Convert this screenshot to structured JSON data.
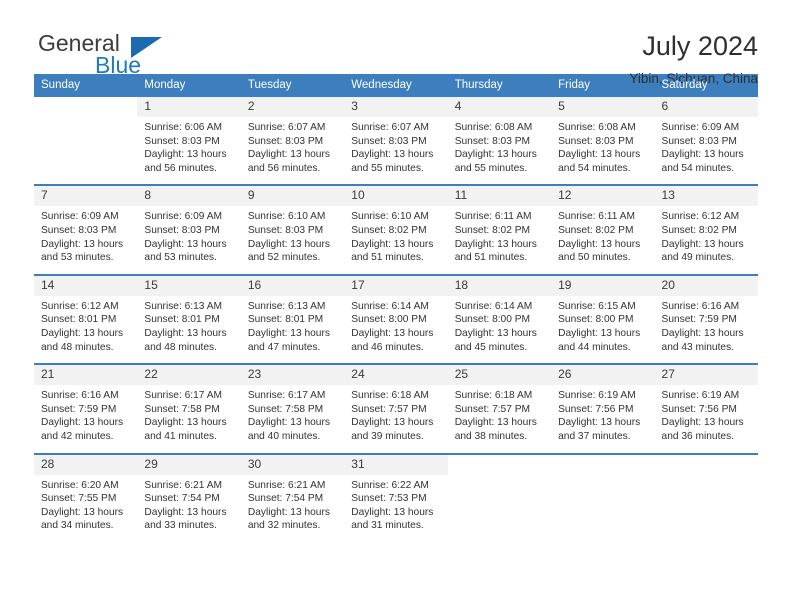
{
  "brand": {
    "name_part1": "General",
    "name_part2": "Blue",
    "accent_color": "#1a6bb0",
    "header_color": "#3d7ebf"
  },
  "header": {
    "title": "July 2024",
    "subtitle": "Yibin, Sichuan, China"
  },
  "calendar": {
    "weekday_headers": [
      "Sunday",
      "Monday",
      "Tuesday",
      "Wednesday",
      "Thursday",
      "Friday",
      "Saturday"
    ],
    "weeks": [
      [
        {
          "day": "",
          "sunrise": "",
          "sunset": "",
          "daylight": "",
          "blank": true
        },
        {
          "day": "1",
          "sunrise": "Sunrise: 6:06 AM",
          "sunset": "Sunset: 8:03 PM",
          "daylight": "Daylight: 13 hours and 56 minutes."
        },
        {
          "day": "2",
          "sunrise": "Sunrise: 6:07 AM",
          "sunset": "Sunset: 8:03 PM",
          "daylight": "Daylight: 13 hours and 56 minutes."
        },
        {
          "day": "3",
          "sunrise": "Sunrise: 6:07 AM",
          "sunset": "Sunset: 8:03 PM",
          "daylight": "Daylight: 13 hours and 55 minutes."
        },
        {
          "day": "4",
          "sunrise": "Sunrise: 6:08 AM",
          "sunset": "Sunset: 8:03 PM",
          "daylight": "Daylight: 13 hours and 55 minutes."
        },
        {
          "day": "5",
          "sunrise": "Sunrise: 6:08 AM",
          "sunset": "Sunset: 8:03 PM",
          "daylight": "Daylight: 13 hours and 54 minutes."
        },
        {
          "day": "6",
          "sunrise": "Sunrise: 6:09 AM",
          "sunset": "Sunset: 8:03 PM",
          "daylight": "Daylight: 13 hours and 54 minutes."
        }
      ],
      [
        {
          "day": "7",
          "sunrise": "Sunrise: 6:09 AM",
          "sunset": "Sunset: 8:03 PM",
          "daylight": "Daylight: 13 hours and 53 minutes."
        },
        {
          "day": "8",
          "sunrise": "Sunrise: 6:09 AM",
          "sunset": "Sunset: 8:03 PM",
          "daylight": "Daylight: 13 hours and 53 minutes."
        },
        {
          "day": "9",
          "sunrise": "Sunrise: 6:10 AM",
          "sunset": "Sunset: 8:03 PM",
          "daylight": "Daylight: 13 hours and 52 minutes."
        },
        {
          "day": "10",
          "sunrise": "Sunrise: 6:10 AM",
          "sunset": "Sunset: 8:02 PM",
          "daylight": "Daylight: 13 hours and 51 minutes."
        },
        {
          "day": "11",
          "sunrise": "Sunrise: 6:11 AM",
          "sunset": "Sunset: 8:02 PM",
          "daylight": "Daylight: 13 hours and 51 minutes."
        },
        {
          "day": "12",
          "sunrise": "Sunrise: 6:11 AM",
          "sunset": "Sunset: 8:02 PM",
          "daylight": "Daylight: 13 hours and 50 minutes."
        },
        {
          "day": "13",
          "sunrise": "Sunrise: 6:12 AM",
          "sunset": "Sunset: 8:02 PM",
          "daylight": "Daylight: 13 hours and 49 minutes."
        }
      ],
      [
        {
          "day": "14",
          "sunrise": "Sunrise: 6:12 AM",
          "sunset": "Sunset: 8:01 PM",
          "daylight": "Daylight: 13 hours and 48 minutes."
        },
        {
          "day": "15",
          "sunrise": "Sunrise: 6:13 AM",
          "sunset": "Sunset: 8:01 PM",
          "daylight": "Daylight: 13 hours and 48 minutes."
        },
        {
          "day": "16",
          "sunrise": "Sunrise: 6:13 AM",
          "sunset": "Sunset: 8:01 PM",
          "daylight": "Daylight: 13 hours and 47 minutes."
        },
        {
          "day": "17",
          "sunrise": "Sunrise: 6:14 AM",
          "sunset": "Sunset: 8:00 PM",
          "daylight": "Daylight: 13 hours and 46 minutes."
        },
        {
          "day": "18",
          "sunrise": "Sunrise: 6:14 AM",
          "sunset": "Sunset: 8:00 PM",
          "daylight": "Daylight: 13 hours and 45 minutes."
        },
        {
          "day": "19",
          "sunrise": "Sunrise: 6:15 AM",
          "sunset": "Sunset: 8:00 PM",
          "daylight": "Daylight: 13 hours and 44 minutes."
        },
        {
          "day": "20",
          "sunrise": "Sunrise: 6:16 AM",
          "sunset": "Sunset: 7:59 PM",
          "daylight": "Daylight: 13 hours and 43 minutes."
        }
      ],
      [
        {
          "day": "21",
          "sunrise": "Sunrise: 6:16 AM",
          "sunset": "Sunset: 7:59 PM",
          "daylight": "Daylight: 13 hours and 42 minutes."
        },
        {
          "day": "22",
          "sunrise": "Sunrise: 6:17 AM",
          "sunset": "Sunset: 7:58 PM",
          "daylight": "Daylight: 13 hours and 41 minutes."
        },
        {
          "day": "23",
          "sunrise": "Sunrise: 6:17 AM",
          "sunset": "Sunset: 7:58 PM",
          "daylight": "Daylight: 13 hours and 40 minutes."
        },
        {
          "day": "24",
          "sunrise": "Sunrise: 6:18 AM",
          "sunset": "Sunset: 7:57 PM",
          "daylight": "Daylight: 13 hours and 39 minutes."
        },
        {
          "day": "25",
          "sunrise": "Sunrise: 6:18 AM",
          "sunset": "Sunset: 7:57 PM",
          "daylight": "Daylight: 13 hours and 38 minutes."
        },
        {
          "day": "26",
          "sunrise": "Sunrise: 6:19 AM",
          "sunset": "Sunset: 7:56 PM",
          "daylight": "Daylight: 13 hours and 37 minutes."
        },
        {
          "day": "27",
          "sunrise": "Sunrise: 6:19 AM",
          "sunset": "Sunset: 7:56 PM",
          "daylight": "Daylight: 13 hours and 36 minutes."
        }
      ],
      [
        {
          "day": "28",
          "sunrise": "Sunrise: 6:20 AM",
          "sunset": "Sunset: 7:55 PM",
          "daylight": "Daylight: 13 hours and 34 minutes."
        },
        {
          "day": "29",
          "sunrise": "Sunrise: 6:21 AM",
          "sunset": "Sunset: 7:54 PM",
          "daylight": "Daylight: 13 hours and 33 minutes."
        },
        {
          "day": "30",
          "sunrise": "Sunrise: 6:21 AM",
          "sunset": "Sunset: 7:54 PM",
          "daylight": "Daylight: 13 hours and 32 minutes."
        },
        {
          "day": "31",
          "sunrise": "Sunrise: 6:22 AM",
          "sunset": "Sunset: 7:53 PM",
          "daylight": "Daylight: 13 hours and 31 minutes."
        },
        {
          "day": "",
          "sunrise": "",
          "sunset": "",
          "daylight": "",
          "blank": true
        },
        {
          "day": "",
          "sunrise": "",
          "sunset": "",
          "daylight": "",
          "blank": true
        },
        {
          "day": "",
          "sunrise": "",
          "sunset": "",
          "daylight": "",
          "blank": true
        }
      ]
    ]
  }
}
